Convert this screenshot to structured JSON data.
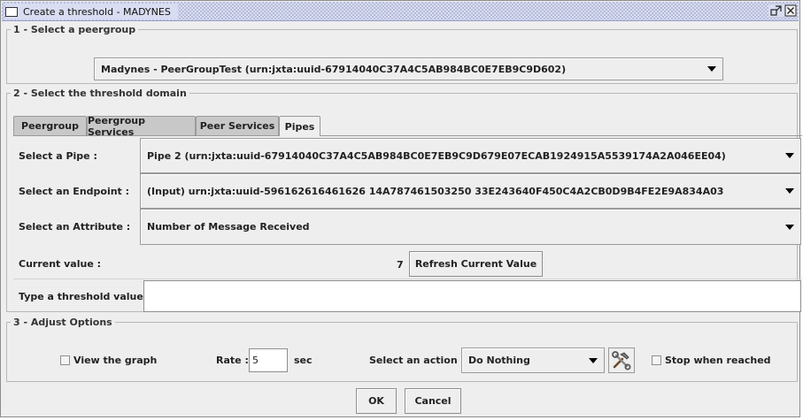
{
  "window": {
    "title": "Create a threshold - MADYNES"
  },
  "section1": {
    "legend": "1 - Select a peergroup",
    "peergroup_value": "Madynes - PeerGroupTest (urn:jxta:uuid-67914040C37A4C5AB984BC0E7EB9C9D602)"
  },
  "section2": {
    "legend": "2 - Select the threshold domain",
    "tabs": [
      {
        "label": "Peergroup",
        "active": false
      },
      {
        "label": "Peergroup Services",
        "active": false
      },
      {
        "label": "Peer Services",
        "active": false
      },
      {
        "label": "Pipes",
        "active": true
      }
    ],
    "pipe_label": "Select a Pipe :",
    "pipe_value": "Pipe 2 (urn:jxta:uuid-67914040C37A4C5AB984BC0E7EB9C9D679E07ECAB1924915A5539174A2A046EE04)",
    "endpoint_label": "Select an Endpoint :",
    "endpoint_value": "(Input) urn:jxta:uuid-596162616461626 14A787461503250 33E243640F450C4A2CB0D9B4FE2E9A834A03",
    "attribute_label": "Select an Attribute :",
    "attribute_value": "Number of Message Received",
    "current_label": "Current value :",
    "current_value": "7",
    "refresh_label": "Refresh Current Value",
    "threshold_label": "Type a threshold value :",
    "threshold_value": ""
  },
  "section3": {
    "legend": "3 - Adjust Options",
    "view_graph_label": "View the graph",
    "rate_label": "Rate :",
    "rate_value": "5",
    "rate_unit": "sec",
    "action_label": "Select an action :",
    "action_value": "Do Nothing",
    "stop_label": "Stop when reached"
  },
  "footer": {
    "ok_label": "OK",
    "cancel_label": "Cancel"
  },
  "icons": {
    "window": "window-icon",
    "restore": "restore-icon",
    "close": "close-icon",
    "tools": "tools-icon"
  }
}
